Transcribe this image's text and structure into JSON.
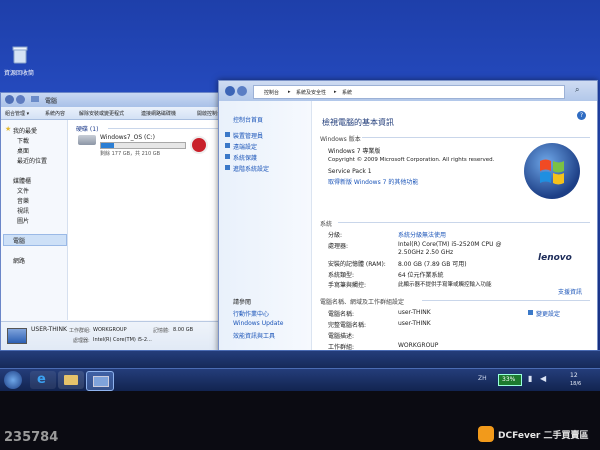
{
  "desktop": {
    "icon_label": "資源回收筒"
  },
  "explorer": {
    "address": "電腦",
    "toolbar": [
      "組合管理 ▾",
      "系統內容",
      "解除安裝或變更程式",
      "連接網路磁碟機",
      "開啟控制台"
    ],
    "nav": {
      "favorites": "我的最愛",
      "favorites_items": [
        "下載",
        "桌面",
        "最近的位置"
      ],
      "libraries": "媒體櫃",
      "libraries_items": [
        "文件",
        "音樂",
        "視訊",
        "圖片"
      ],
      "computer": "電腦",
      "network": "網路"
    },
    "drives_header": "硬碟 (1)",
    "drive_name": "Windows7_OS (C:)",
    "drive_free": "剩餘 177 GB，共 210 GB",
    "drive_fill": 0.16,
    "details": {
      "name": "USER-THINK",
      "workgroup_label": "工作群組:",
      "workgroup": "WORKGROUP",
      "memory_label": "記憶體:",
      "memory": "8.00 GB",
      "processor_label": "處理器:",
      "processor": "Intel(R) Core(TM) i5-2..."
    }
  },
  "system": {
    "breadcrumb": [
      "控制台",
      "系統及安全性",
      "系統"
    ],
    "left_links": [
      "控制台首頁",
      "裝置管理員",
      "遠端設定",
      "系統保護",
      "進階系統設定"
    ],
    "see_also": "請參閱",
    "see_also_links": [
      "行動作業中心",
      "Windows Update",
      "效能資訊與工具"
    ],
    "title": "檢視電腦的基本資訊",
    "edition_section": "Windows 版本",
    "edition": "Windows 7 專業版",
    "copyright": "Copyright © 2009 Microsoft Corporation. All rights reserved.",
    "service_pack": "Service Pack 1",
    "upgrade_link": "取得新版 Windows 7 的其他功能",
    "system_section": "系統",
    "rows": [
      {
        "label": "分級:",
        "value": "系統分級無法使用"
      },
      {
        "label": "處理器:",
        "value": "Intel(R) Core(TM) i5-2520M CPU @ 2.50GHz   2.50 GHz"
      },
      {
        "label": "安裝的記憶體 (RAM):",
        "value": "8.00 GB (7.89 GB 可用)"
      },
      {
        "label": "系統類型:",
        "value": "64 位元作業系統"
      },
      {
        "label": "手寫筆與觸控:",
        "value": "此顯示器不提供手寫筆或觸控輸入功能"
      }
    ],
    "support_link": "支援資訊",
    "brand": "lenovo",
    "computer_section": "電腦名稱、網域及工作群組設定",
    "computer_rows": [
      {
        "label": "電腦名稱:",
        "value": "user-THINK"
      },
      {
        "label": "完整電腦名稱:",
        "value": "user-THINK"
      },
      {
        "label": "電腦描述:",
        "value": ""
      },
      {
        "label": "工作群組:",
        "value": "WORKGROUP"
      }
    ],
    "change_settings": "變更設定"
  },
  "taskbar": {
    "battery": "33%",
    "lang": "ZH",
    "time": "12",
    "date": "18/6"
  },
  "watermark": {
    "id": "235784",
    "site": "DCFever 二手買賣區"
  },
  "colors": {
    "desktop": "#2850c8",
    "link": "#1a54b8",
    "taskbar": "#122450"
  }
}
